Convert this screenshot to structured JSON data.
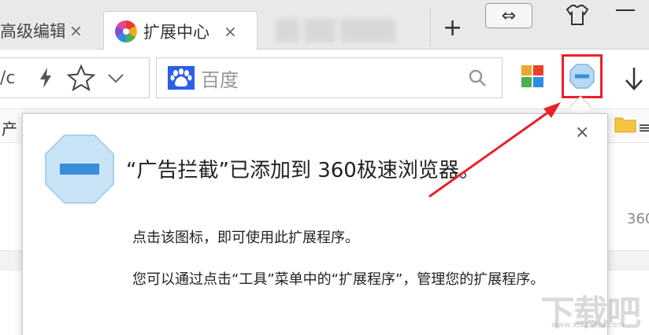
{
  "tabs": [
    {
      "label": "高级编辑",
      "close": "×"
    },
    {
      "label": "扩展中心",
      "close": "×",
      "favicon": "pinwheel-favicon-icon"
    }
  ],
  "tabstrip": {
    "new_tab": "+",
    "switch_icon": "⇔"
  },
  "toolbar": {
    "url_fragment": "/c",
    "search_placeholder": "百度",
    "icons": [
      "lightning-icon",
      "star-icon",
      "chevron-down-icon",
      "baidu-paw-icon",
      "search-icon",
      "app-grid-icon",
      "adblock-icon",
      "download-icon"
    ]
  },
  "bookmarks": {
    "left_text": "产",
    "right_text": "≡"
  },
  "page": {
    "side_text": "360"
  },
  "popup": {
    "close": "×",
    "title": "“广告拦截”已添加到 360极速浏览器。",
    "line1": "点击该图标，即可使用此扩展程序。",
    "line2": "您可以通过点击“工具”菜单中的“扩展程序”，管理您的扩展程序。"
  },
  "colors": {
    "highlight": "#e8222a",
    "ext_icon_fill": "#b7d9f3",
    "ext_icon_bar": "#3a8ed8"
  },
  "watermark": {
    "main": "下载吧",
    "sub": "www.xiazaiba.com"
  }
}
